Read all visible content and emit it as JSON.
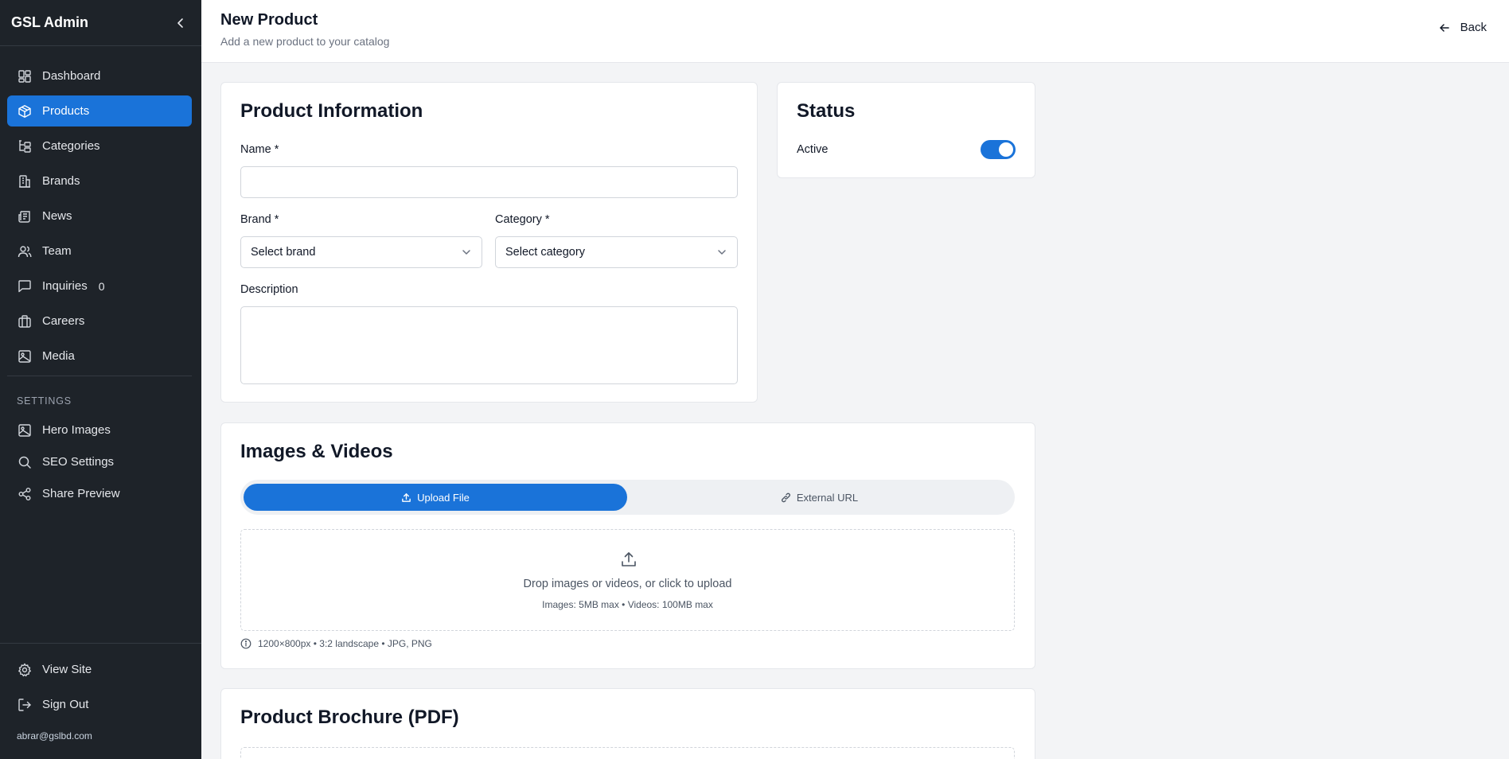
{
  "sidebar": {
    "title": "GSL Admin",
    "items": [
      {
        "label": "Dashboard"
      },
      {
        "label": "Products"
      },
      {
        "label": "Categories"
      },
      {
        "label": "Brands"
      },
      {
        "label": "News"
      },
      {
        "label": "Team"
      },
      {
        "label": "Inquiries",
        "badge": "0"
      },
      {
        "label": "Careers"
      },
      {
        "label": "Media"
      }
    ],
    "settings_heading": "SETTINGS",
    "settings_items": [
      {
        "label": "Hero Images"
      },
      {
        "label": "SEO Settings"
      },
      {
        "label": "Share Preview"
      }
    ],
    "footer_items": [
      {
        "label": "View Site"
      },
      {
        "label": "Sign Out"
      }
    ],
    "user_email": "abrar@gslbd.com"
  },
  "header": {
    "title": "New Product",
    "subtitle": "Add a new product to your catalog",
    "back_label": "Back"
  },
  "product_info": {
    "title": "Product Information",
    "name_label": "Name *",
    "name_value": "",
    "brand_label": "Brand *",
    "brand_value": "Select brand",
    "category_label": "Category *",
    "category_value": "Select category",
    "description_label": "Description",
    "description_value": ""
  },
  "status": {
    "title": "Status",
    "active_label": "Active",
    "active": true
  },
  "media": {
    "title": "Images & Videos",
    "tabs": [
      {
        "label": "Upload File",
        "active": true
      },
      {
        "label": "External URL",
        "active": false
      }
    ],
    "drop_text": "Drop images or videos, or click to upload",
    "drop_sub": "Images: 5MB max • Videos: 100MB max",
    "hint": "1200×800px • 3:2 landscape • JPG, PNG"
  },
  "brochure": {
    "title": "Product Brochure (PDF)"
  },
  "colors": {
    "sidebar_bg": "#1e2329",
    "accent": "#1a73d9",
    "page_bg": "#f3f4f6"
  }
}
